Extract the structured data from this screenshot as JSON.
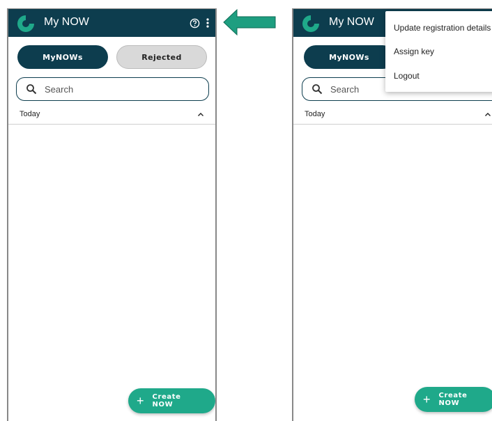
{
  "app": {
    "title": "My NOW"
  },
  "tabs": {
    "mynows": "MyNOWs",
    "rejected": "Rejected"
  },
  "search": {
    "placeholder": "Search"
  },
  "section": {
    "label": "Today"
  },
  "fab": {
    "label": "Create NOW",
    "plus": "+"
  },
  "menu": {
    "items": [
      "Update registration details",
      "Assign key",
      "Logout"
    ]
  },
  "colors": {
    "appbar": "#0d3d4e",
    "accent": "#1fa98a",
    "arrow": "#1e9e80"
  },
  "icons": [
    "logo-icon",
    "help-icon",
    "more-vert-icon",
    "search-icon",
    "chevron-up-icon",
    "plus-icon",
    "arrow-left-icon"
  ]
}
